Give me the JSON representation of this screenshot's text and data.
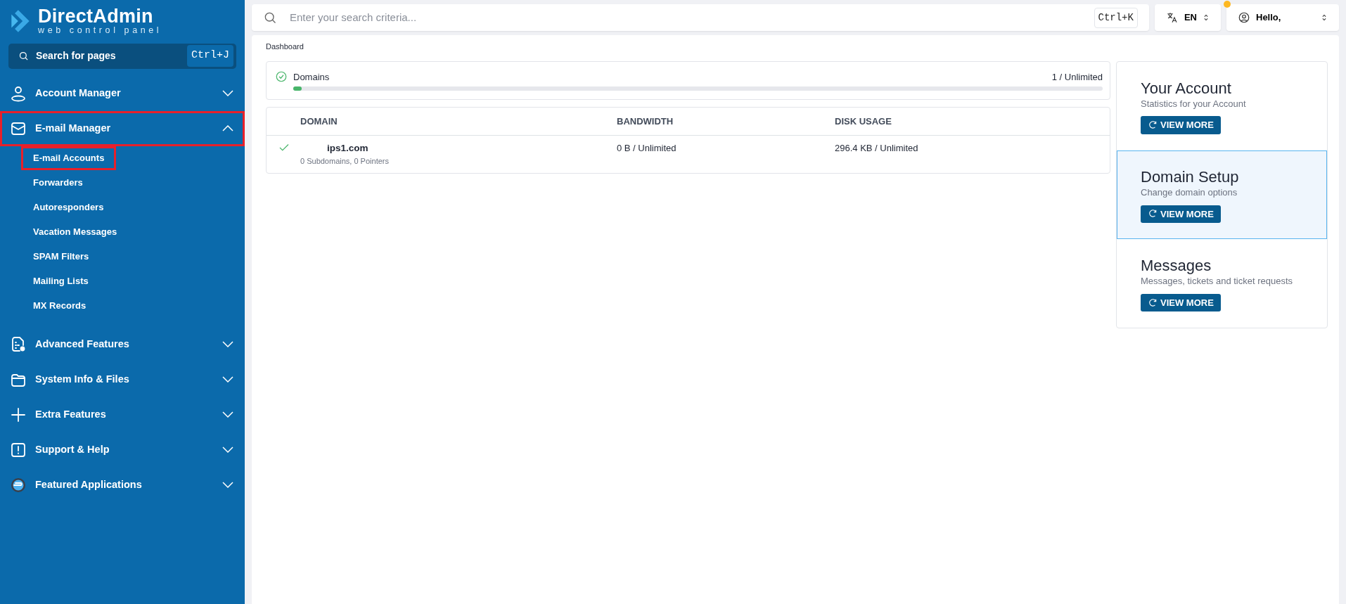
{
  "logo": {
    "title": "DirectAdmin",
    "subtitle": "web control panel"
  },
  "sidebar": {
    "search": {
      "placeholder": "Search for pages",
      "shortcut": "Ctrl+J"
    },
    "items": [
      {
        "label": "Account Manager",
        "expanded": false,
        "highlighted": false
      },
      {
        "label": "E-mail Manager",
        "expanded": true,
        "highlighted": true,
        "children": [
          {
            "label": "E-mail Accounts",
            "highlighted": true
          },
          {
            "label": "Forwarders",
            "highlighted": false
          },
          {
            "label": "Autoresponders",
            "highlighted": false
          },
          {
            "label": "Vacation Messages",
            "highlighted": false
          },
          {
            "label": "SPAM Filters",
            "highlighted": false
          },
          {
            "label": "Mailing Lists",
            "highlighted": false
          },
          {
            "label": "MX Records",
            "highlighted": false
          }
        ]
      },
      {
        "label": "Advanced Features",
        "expanded": false,
        "highlighted": false
      },
      {
        "label": "System Info & Files",
        "expanded": false,
        "highlighted": false
      },
      {
        "label": "Extra Features",
        "expanded": false,
        "highlighted": false
      },
      {
        "label": "Support & Help",
        "expanded": false,
        "highlighted": false
      },
      {
        "label": "Featured Applications",
        "expanded": false,
        "highlighted": false
      }
    ]
  },
  "topbar": {
    "search": {
      "placeholder": "Enter your search criteria...",
      "shortcut": "Ctrl+K"
    },
    "language": "EN",
    "user": {
      "greeting": "Hello,",
      "notification": true
    }
  },
  "breadcrumb": "Dashboard",
  "usage": {
    "label": "Domains",
    "value": "1 / Unlimited",
    "level": 0.008
  },
  "table": {
    "columns": [
      "DOMAIN",
      "BANDWIDTH",
      "DISK USAGE"
    ],
    "rows": [
      {
        "ok": true,
        "domain": "ips1.com",
        "details": "0 Subdomains, 0 Pointers",
        "bandwidth": "0 B / Unlimited",
        "disk": "296.4 KB / Unlimited"
      }
    ]
  },
  "cards": [
    {
      "title": "Your Account",
      "subtitle": "Statistics for your Account",
      "button": "VIEW MORE",
      "selected": false
    },
    {
      "title": "Domain Setup",
      "subtitle": "Change domain options",
      "button": "VIEW MORE",
      "selected": true
    },
    {
      "title": "Messages",
      "subtitle": "Messages, tickets and ticket requests",
      "button": "VIEW MORE",
      "selected": false
    }
  ]
}
